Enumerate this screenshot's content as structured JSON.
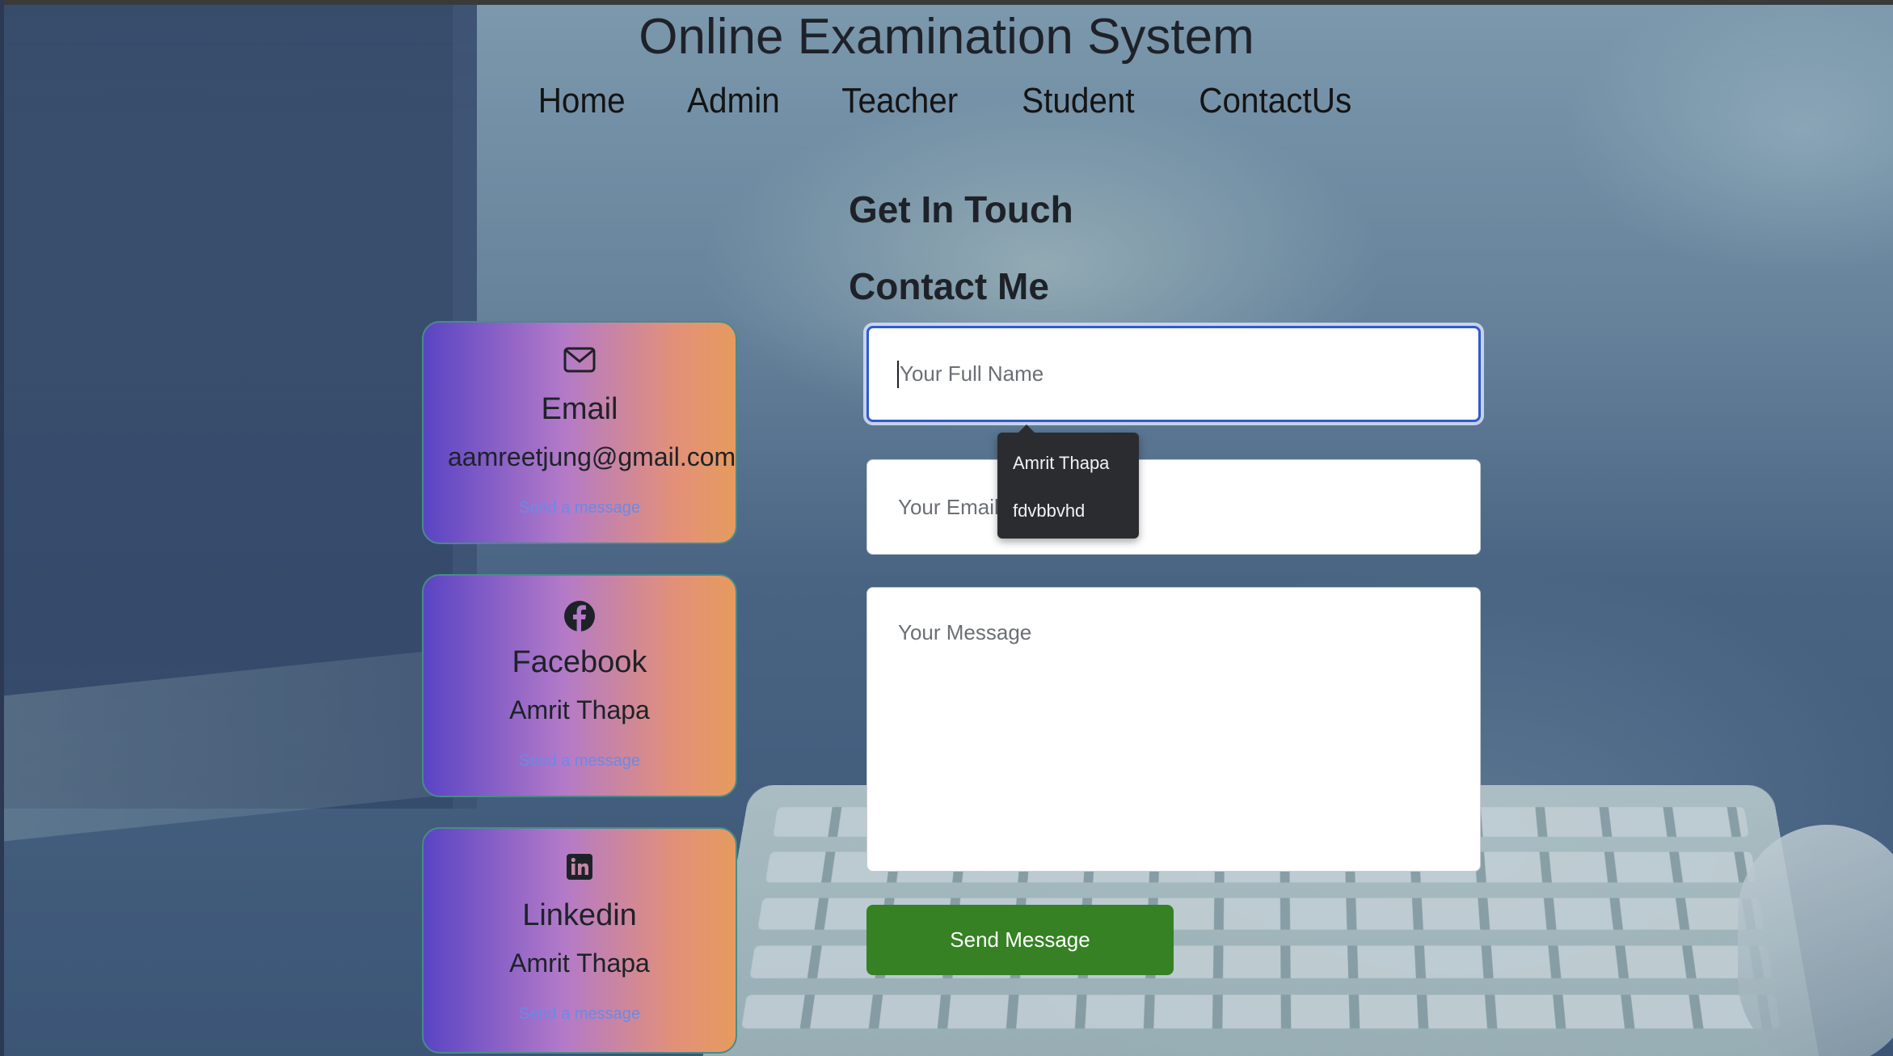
{
  "site": {
    "title": "Online Examination System"
  },
  "nav": {
    "items": [
      "Home",
      "Admin",
      "Teacher",
      "Student",
      "ContactUs"
    ]
  },
  "contact": {
    "heading_small": "Get In Touch",
    "heading_large": "Contact Me"
  },
  "cards": [
    {
      "icon": "envelope-icon",
      "title": "Email",
      "value": "aamreetjung@gmail.com",
      "link": "Send a message"
    },
    {
      "icon": "facebook-icon",
      "title": "Facebook",
      "value": "Amrit Thapa",
      "link": "Send a message"
    },
    {
      "icon": "linkedin-icon",
      "title": "Linkedin",
      "value": "Amrit Thapa",
      "link": "Send a message"
    }
  ],
  "form": {
    "name_placeholder": "Your Full Name",
    "email_placeholder": "Your Email",
    "message_placeholder": "Your Message",
    "submit_label": "Send Message"
  },
  "autofill": {
    "suggestions": [
      "Amrit Thapa",
      "fdvbbvhd"
    ]
  },
  "colors": {
    "submit": "#358123",
    "focus_border": "#2f5bd0",
    "card_gradient_start": "#5a44c4",
    "card_gradient_end": "#e69b5e",
    "link": "#6a8ae6"
  }
}
